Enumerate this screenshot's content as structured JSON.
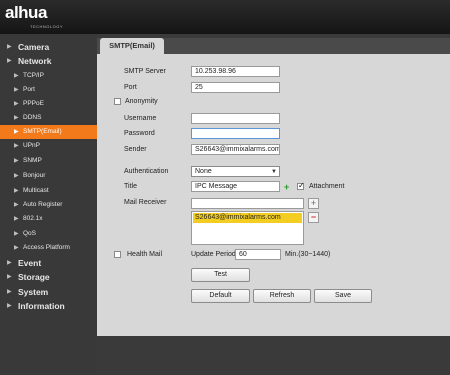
{
  "brand": {
    "logo": "alhua",
    "sub": "TECHNOLOGY"
  },
  "sidebar": {
    "items": [
      {
        "label": "Camera",
        "level": 1
      },
      {
        "label": "Network",
        "level": 1
      },
      {
        "label": "TCP/IP",
        "level": 2
      },
      {
        "label": "Port",
        "level": 2
      },
      {
        "label": "PPPoE",
        "level": 2
      },
      {
        "label": "DDNS",
        "level": 2
      },
      {
        "label": "SMTP(Email)",
        "level": 2,
        "active": true
      },
      {
        "label": "UPnP",
        "level": 2
      },
      {
        "label": "SNMP",
        "level": 2
      },
      {
        "label": "Bonjour",
        "level": 2
      },
      {
        "label": "Multicast",
        "level": 2
      },
      {
        "label": "Auto Register",
        "level": 2
      },
      {
        "label": "802.1x",
        "level": 2
      },
      {
        "label": "QoS",
        "level": 2
      },
      {
        "label": "Access Platform",
        "level": 2
      },
      {
        "label": "Event",
        "level": 1
      },
      {
        "label": "Storage",
        "level": 1
      },
      {
        "label": "System",
        "level": 1
      },
      {
        "label": "Information",
        "level": 1
      }
    ],
    "arrow_glyph": "▶"
  },
  "tab": {
    "label": "SMTP(Email)"
  },
  "form": {
    "smtp_server_label": "SMTP Server",
    "smtp_server_value": "10.253.98.96",
    "port_label": "Port",
    "port_value": "25",
    "anonymity_label": "Anonymity",
    "username_label": "Username",
    "username_value": "",
    "password_label": "Password",
    "password_value": "",
    "sender_label": "Sender",
    "sender_value": "S26643@immixalarms.com",
    "authentication_label": "Authentication",
    "authentication_value": "None",
    "title_label": "Title",
    "title_value": "IPC Message",
    "attachment_label": "Attachment",
    "mail_receiver_label": "Mail Receiver",
    "mail_receiver_value": "",
    "receivers": [
      "S26643@immixalarms.com"
    ],
    "health_mail_label": "Health Mail",
    "update_period_label": "Update Period",
    "update_period_value": "60",
    "update_period_unit": "Min.(30~1440)",
    "plus_glyph": "+",
    "minus_glyph": "−",
    "caret_glyph": "▼"
  },
  "buttons": {
    "test": "Test",
    "default": "Default",
    "refresh": "Refresh",
    "save": "Save"
  },
  "colors": {
    "accent": "#f27a1a",
    "selection": "#f3cd22",
    "sidebar_bg": "#393939",
    "panel_bg": "#d7d7d7"
  }
}
